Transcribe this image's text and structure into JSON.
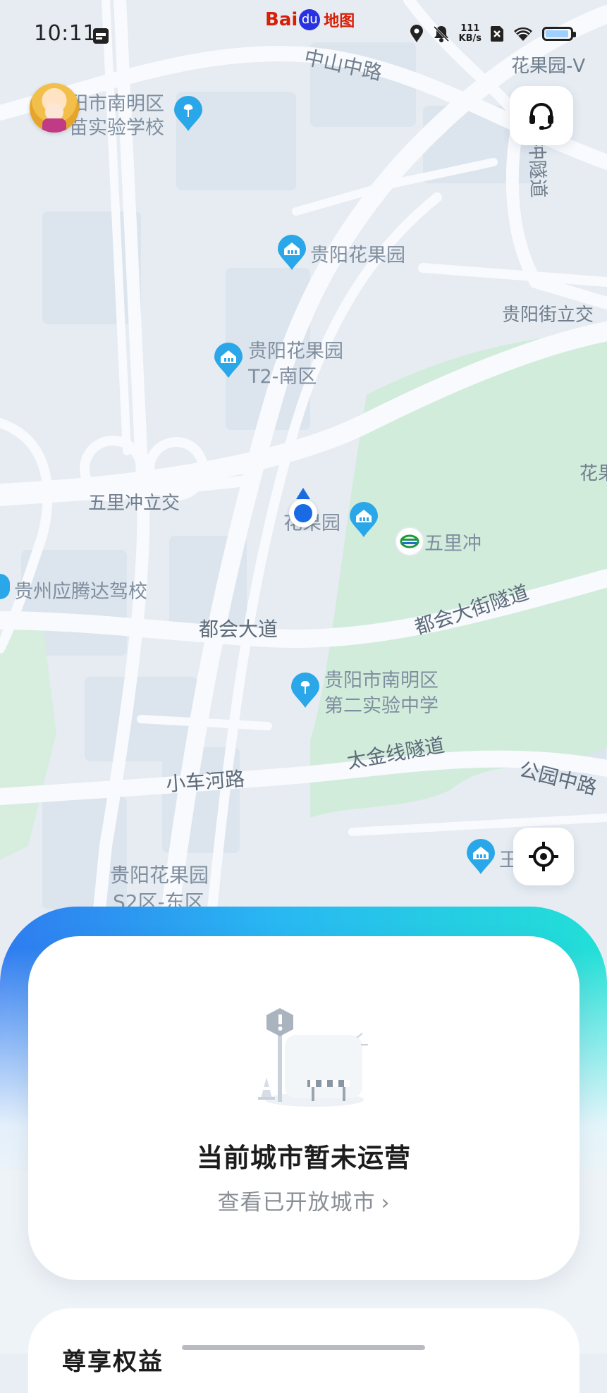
{
  "status_bar": {
    "time": "10:11",
    "net_speed_value": "111",
    "net_speed_unit": "KB/s",
    "icons": [
      "calendar-icon",
      "location-icon",
      "mute-icon",
      "sim-off-icon",
      "wifi-icon",
      "battery-icon"
    ],
    "battery_level": 0.9
  },
  "app_logo": {
    "part1": "Bai",
    "part2": "du",
    "part3": "地图"
  },
  "map": {
    "roads": {
      "zhongshan": "中山中路",
      "duhui_avenue": "都会大道",
      "duhui_tunnel": "都会大街隧道",
      "xiaochehe": "小车河路",
      "taijin_tunnel": "太金线隧道",
      "gongyuan": "公园中路",
      "chong_tunnel": "冲隧道",
      "wulichong_interchange": "五里冲立交",
      "guiyang_street_interchange": "贵阳街立交",
      "huaguoyuan_v": "花果园-V",
      "hua_right": "花果"
    },
    "pois": [
      {
        "label": "阳市南明区",
        "label2": "苗实验学校",
        "icon": "school-pin-icon"
      },
      {
        "label": "贵阳花果园",
        "icon": "residential-pin-icon"
      },
      {
        "label": "贵阳花果园",
        "label2": "T2-南区",
        "icon": "residential-pin-icon"
      },
      {
        "label": "花果园",
        "icon": "residential-pin-icon"
      },
      {
        "label": "五里冲",
        "icon": "metro-station-icon"
      },
      {
        "label": "贵州应腾达驾校",
        "icon": "poi-pin-icon"
      },
      {
        "label": "贵阳市南明区",
        "label2": "第二实验中学",
        "icon": "school-pin-icon"
      },
      {
        "label": "王",
        "icon": "residential-pin-icon"
      },
      {
        "label": "贵阳花果园",
        "label2": "S2区-东区",
        "icon": "residential-pin-icon"
      }
    ],
    "colors": {
      "land": "#e6ecf2",
      "block": "#dce4ed",
      "road": "#f8fafd",
      "major_road": "#ffffff",
      "green": "#d2ecdc",
      "text": "#7f8e9f",
      "pin": "#2aa7e8",
      "user_dot": "#1a6ae3"
    }
  },
  "controls": {
    "avatar": "avatar",
    "customer_service": "headset-icon",
    "locate": "locate-crosshair-icon"
  },
  "status_card": {
    "title": "当前城市暂未运营",
    "link": "查看已开放城市",
    "link_icon": "chevron-right-icon",
    "illustration": "road-closed-illustration"
  },
  "next_card": {
    "title": "尊享权益"
  },
  "accent_colors": {
    "glow_left": "#2f7bf0",
    "glow_mid": "#29b7f2",
    "glow_right": "#22e0d6"
  }
}
